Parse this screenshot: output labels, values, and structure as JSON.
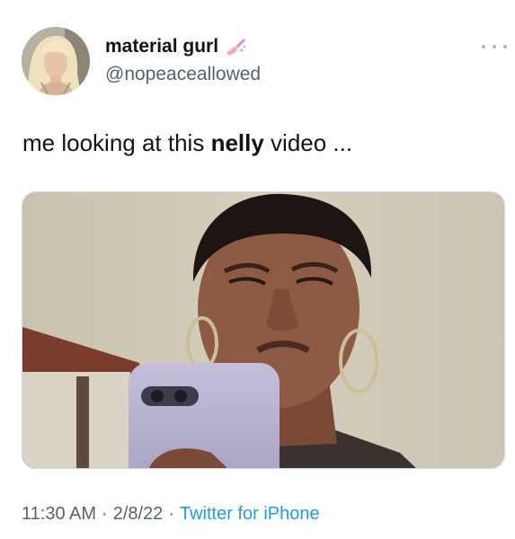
{
  "user": {
    "display_name": "material gurl",
    "name_emoji": "nail-polish-emoji",
    "handle": "@nopeaceallowed",
    "avatar": "user-avatar"
  },
  "tweet": {
    "text_before": "me looking at this ",
    "text_bold": "nelly",
    "text_after": " video ..."
  },
  "media": {
    "kind": "embedded-photo"
  },
  "meta": {
    "time": "11:30 AM",
    "separator": "·",
    "date": "2/8/22",
    "source": "Twitter for iPhone"
  },
  "icons": {
    "more": "more-options-icon"
  },
  "colors": {
    "text": "#0f1419",
    "secondary": "#536471",
    "link": "#1d9bf0",
    "more_dots": "#aab8c2"
  }
}
